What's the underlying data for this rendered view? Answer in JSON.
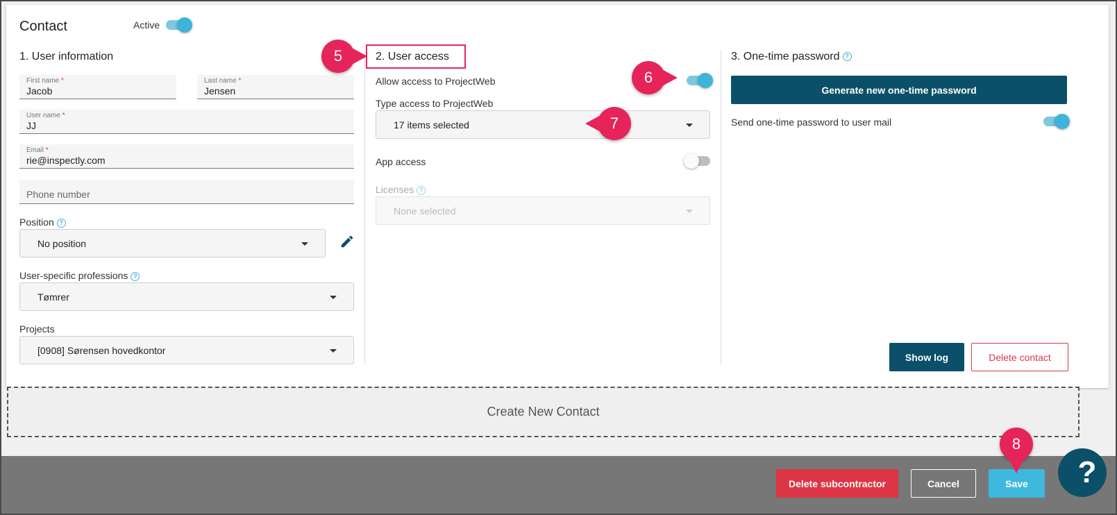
{
  "contact": {
    "title": "Contact",
    "active_label": "Active",
    "active_on": true
  },
  "user_info": {
    "heading": "1. User information",
    "first_name_label": "First name",
    "first_name_value": "Jacob",
    "last_name_label": "Last name",
    "last_name_value": "Jensen",
    "username_label": "User name",
    "username_value": "JJ",
    "email_label": "Email",
    "email_value": "rie@inspectly.com",
    "phone_placeholder": "Phone number",
    "required_mark": "*",
    "position_label": "Position",
    "position_value": "No position",
    "professions_label": "User-specific professions",
    "professions_value": "Tømrer",
    "projects_label": "Projects",
    "projects_value": "[0908] Sørensen hovedkontor"
  },
  "user_access": {
    "heading": "2. User access",
    "allow_label": "Allow access to ProjectWeb",
    "allow_on": true,
    "type_label": "Type access to ProjectWeb",
    "type_value": "17 items selected",
    "app_access_label": "App access",
    "app_access_on": false,
    "licenses_label": "Licenses",
    "licenses_value": "None selected"
  },
  "otp": {
    "heading": "3. One-time password",
    "generate_button": "Generate new one-time password",
    "send_label": "Send one-time password to user mail",
    "send_on": true,
    "show_log_button": "Show log",
    "delete_contact_button": "Delete contact"
  },
  "create_new_contact": "Create New Contact",
  "footer": {
    "delete_subcontractor": "Delete subcontractor",
    "cancel": "Cancel",
    "save": "Save"
  },
  "annotations": {
    "marker_5": "5",
    "marker_6": "6",
    "marker_7": "7",
    "marker_8": "8",
    "help_glyph": "?"
  },
  "colors": {
    "accent": "#3fb3d9",
    "dark_teal": "#0b5068",
    "danger": "#dc3545",
    "marker": "#e7245a"
  }
}
